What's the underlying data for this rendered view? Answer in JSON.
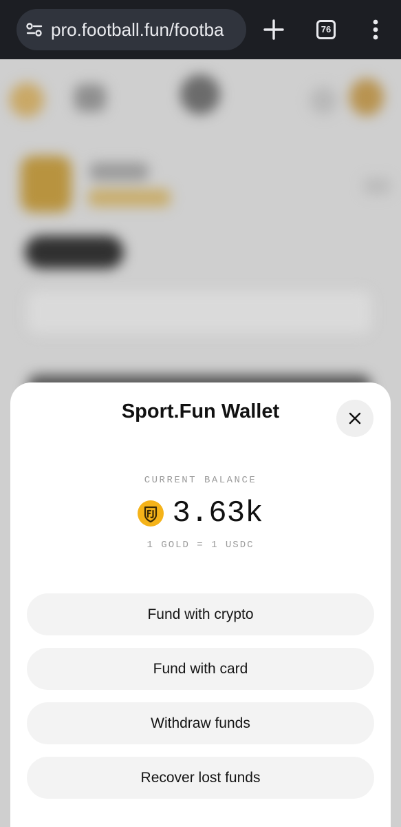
{
  "browser": {
    "url": "pro.football.fun/footba",
    "tab_count": "76",
    "icons": {
      "site_settings": "tune-icon",
      "new_tab": "plus-icon",
      "menu": "more-vertical-icon"
    }
  },
  "wallet": {
    "title": "Sport.Fun Wallet",
    "balance_label": "CURRENT BALANCE",
    "balance_value": "3.63k",
    "currency_icon": "gold-coin-icon",
    "rate_text": "1 GOLD = 1 USDC",
    "actions": [
      {
        "label": "Fund with crypto"
      },
      {
        "label": "Fund with card"
      },
      {
        "label": "Withdraw funds"
      },
      {
        "label": "Recover lost funds"
      }
    ]
  },
  "colors": {
    "browser_bar": "#1c1e23",
    "url_pill": "#30343d",
    "sheet_bg": "#ffffff",
    "button_bg": "#f3f3f3",
    "coin": "#f5b319",
    "muted_text": "#9a9a9a"
  }
}
